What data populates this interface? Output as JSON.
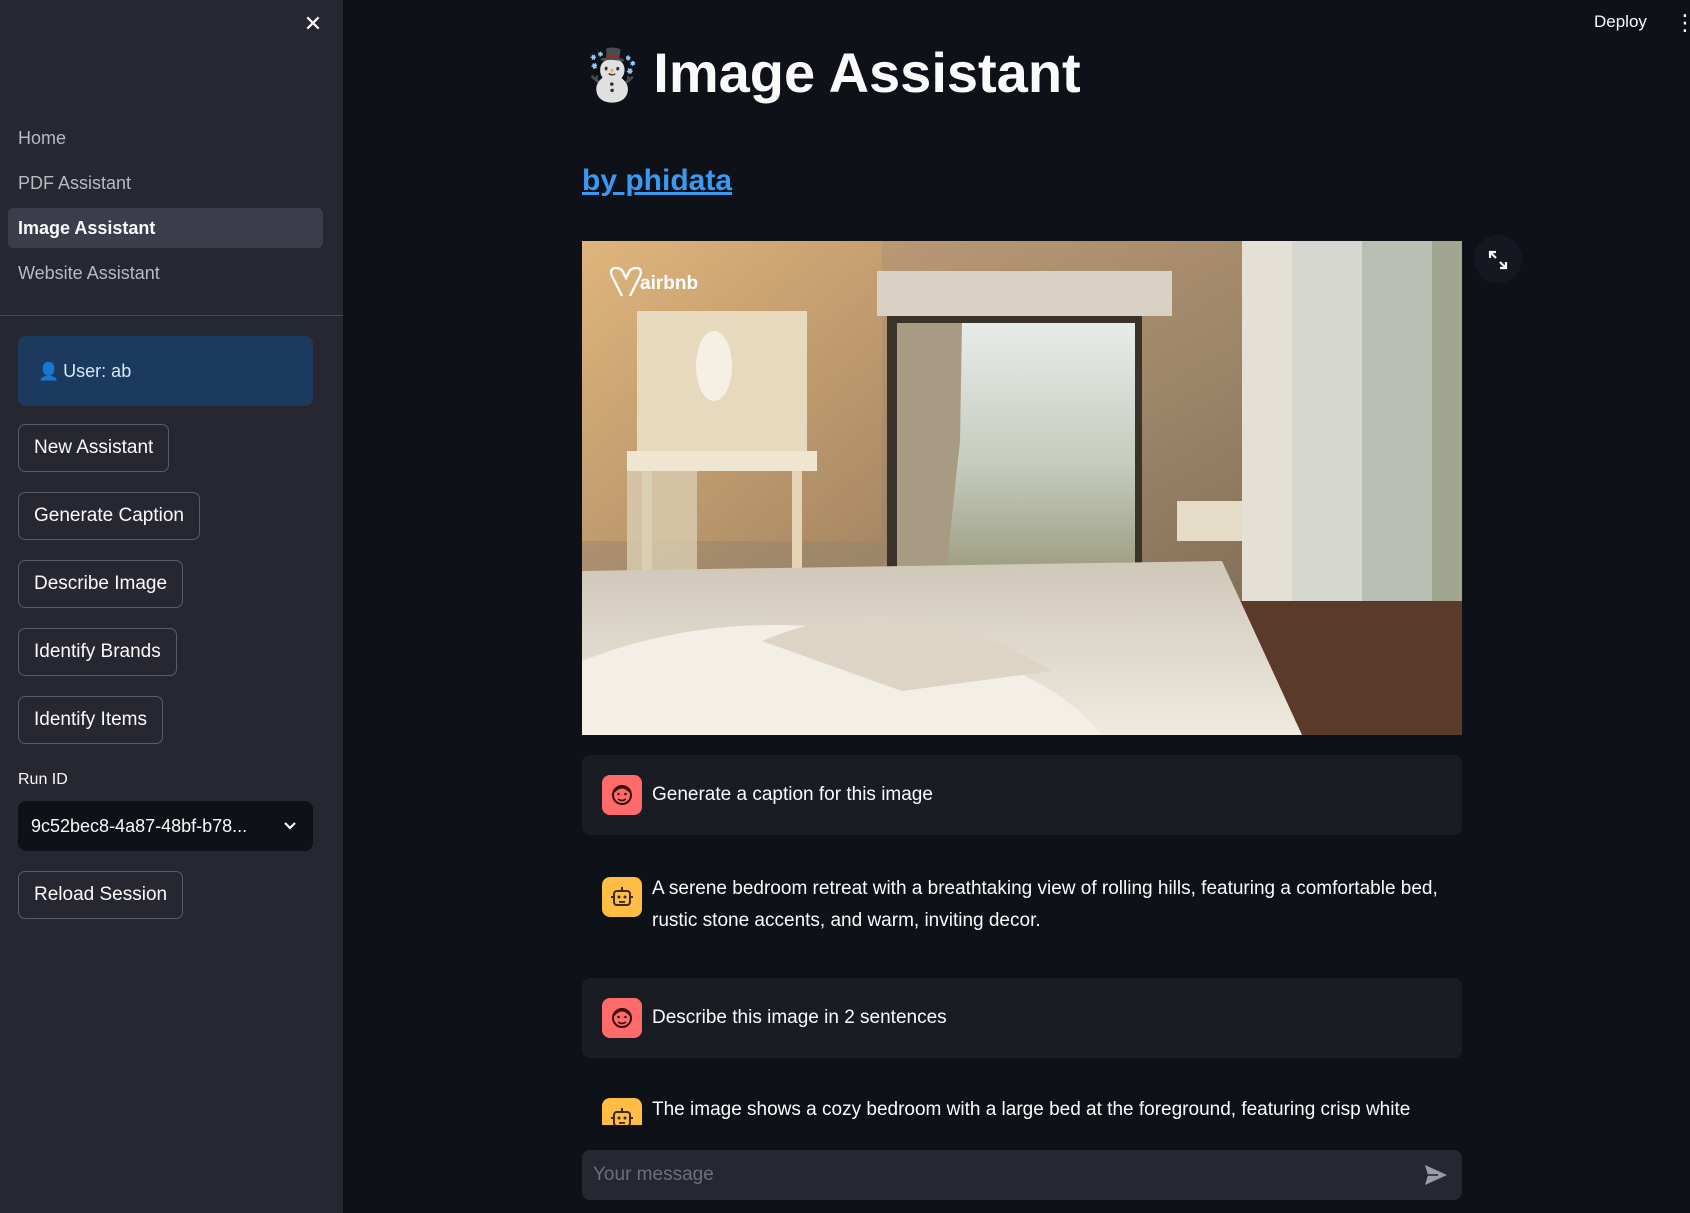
{
  "sidebar": {
    "nav": [
      {
        "label": "Home"
      },
      {
        "label": "PDF Assistant"
      },
      {
        "label": "Image Assistant"
      },
      {
        "label": "Website Assistant"
      }
    ],
    "user_label": "User: ab",
    "user_icon": "user-icon",
    "buttons": {
      "new_assistant": "New Assistant",
      "generate_caption": "Generate Caption",
      "describe_image": "Describe Image",
      "identify_brands": "Identify Brands",
      "identify_items": "Identify Items",
      "reload_session": "Reload Session"
    },
    "run_id_label": "Run ID",
    "run_id_value": "9c52bec8-4a87-48bf-b78..."
  },
  "header": {
    "deploy": "Deploy"
  },
  "main": {
    "title": "Image Assistant",
    "byline": "by phidata",
    "image_brand": "airbnb",
    "messages": [
      {
        "role": "user",
        "text": "Generate a caption for this image"
      },
      {
        "role": "assistant",
        "text": "A serene bedroom retreat with a breathtaking view of rolling hills, featuring a comfortable bed, rustic stone accents, and warm, inviting decor."
      },
      {
        "role": "user",
        "text": "Describe this image in 2 sentences"
      },
      {
        "role": "assistant",
        "text": "The image shows a cozy bedroom with a large bed at the foreground, featuring crisp white"
      }
    ],
    "chat_placeholder": "Your message"
  },
  "colors": {
    "sidebar_bg": "#262730",
    "main_bg": "#0e1117",
    "link": "#3a9af0",
    "user_avatar": "#ff6b6b",
    "bot_avatar": "#ffbd45",
    "user_box_bg": "#1c3a5e"
  }
}
